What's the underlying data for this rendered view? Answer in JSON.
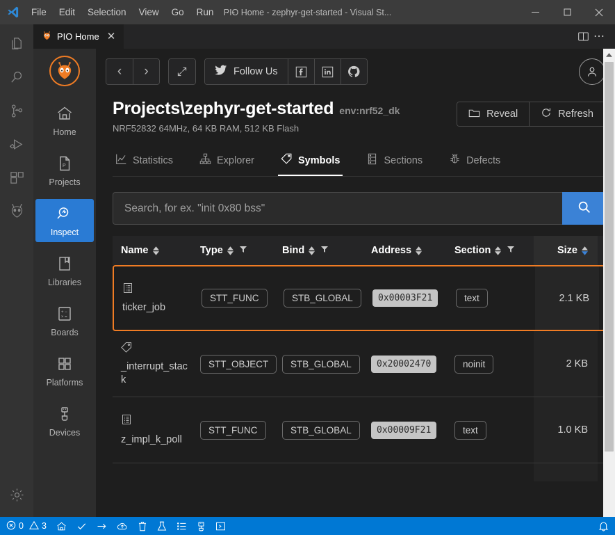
{
  "titlebar": {
    "logo_icon": "vscode-logo-icon",
    "menus": [
      {
        "label": "File"
      },
      {
        "label": "Edit"
      },
      {
        "label": "Selection"
      },
      {
        "label": "View"
      },
      {
        "label": "Go"
      },
      {
        "label": "Run"
      },
      {
        "label": "···"
      }
    ],
    "window_title": "PIO Home - zephyr-get-started - Visual St...",
    "minimize_label": "─",
    "maximize_label": "☐",
    "close_label": "✕"
  },
  "activitybar": {
    "items": [
      {
        "name": "explorer",
        "icon": "files-icon"
      },
      {
        "name": "search",
        "icon": "search-icon"
      },
      {
        "name": "source-control",
        "icon": "source-control-icon"
      },
      {
        "name": "run-and-debug",
        "icon": "run-debug-icon"
      },
      {
        "name": "extensions",
        "icon": "extensions-icon"
      },
      {
        "name": "platformio",
        "icon": "platformio-alien-icon"
      }
    ],
    "bottom": [
      {
        "name": "manage",
        "icon": "gear-icon"
      }
    ]
  },
  "tabbar": {
    "tabs": [
      {
        "label": "PIO Home",
        "icon": "platformio-alien-icon",
        "close_label": "✕",
        "active": true
      }
    ],
    "actions": [
      {
        "name": "split-editor",
        "icon": "split-editor-icon"
      },
      {
        "name": "more-actions",
        "icon": "ellipsis-icon",
        "label": "⋯"
      }
    ]
  },
  "pio_nav": {
    "logo_icon": "platformio-alien-icon",
    "items": [
      {
        "label": "Home",
        "icon": "home-icon",
        "active": false
      },
      {
        "label": "Projects",
        "icon": "projects-icon",
        "active": false
      },
      {
        "label": "Inspect",
        "icon": "inspect-icon",
        "active": true
      },
      {
        "label": "Libraries",
        "icon": "libraries-icon",
        "active": false
      },
      {
        "label": "Boards",
        "icon": "boards-icon",
        "active": false
      },
      {
        "label": "Platforms",
        "icon": "platforms-icon",
        "active": false
      },
      {
        "label": "Devices",
        "icon": "devices-icon",
        "active": false
      }
    ],
    "accent_color": "#2a7bd4",
    "brand_color": "#f07c24"
  },
  "pio_toolbar": {
    "back_label": "‹",
    "forward_label": "›",
    "expand_label": "expand",
    "follow_label": "Follow Us",
    "socials": [
      {
        "name": "facebook",
        "label": "f"
      },
      {
        "name": "linkedin",
        "label": "in"
      },
      {
        "name": "github",
        "label": "gh"
      }
    ],
    "account_label": "account"
  },
  "project": {
    "title": "Projects\\zephyr-get-started",
    "env": "env:nrf52_dk",
    "subtitle": "NRF52832 64MHz, 64 KB RAM, 512 KB Flash",
    "actions": [
      {
        "label": "Reveal",
        "icon": "folder-icon"
      },
      {
        "label": "Refresh",
        "icon": "refresh-icon"
      }
    ]
  },
  "tabs": [
    {
      "label": "Statistics",
      "icon": "chart-line-icon",
      "active": false
    },
    {
      "label": "Explorer",
      "icon": "sitemap-icon",
      "active": false
    },
    {
      "label": "Symbols",
      "icon": "tags-icon",
      "active": true
    },
    {
      "label": "Sections",
      "icon": "sections-icon",
      "active": false
    },
    {
      "label": "Defects",
      "icon": "bug-icon",
      "active": false
    }
  ],
  "search": {
    "placeholder": "Search, for ex. \"init 0x80 bss\"",
    "value": "",
    "button_icon": "search-icon",
    "button_color": "#3b82d6"
  },
  "table": {
    "columns": [
      {
        "label": "Name",
        "sortable": true,
        "filterable": false
      },
      {
        "label": "Type",
        "sortable": true,
        "filterable": true
      },
      {
        "label": "Bind",
        "sortable": true,
        "filterable": true
      },
      {
        "label": "Address",
        "sortable": true,
        "filterable": false
      },
      {
        "label": "Section",
        "sortable": true,
        "filterable": true
      },
      {
        "label": "Size",
        "sortable": true,
        "filterable": false,
        "sorted": "desc"
      }
    ],
    "rows": [
      {
        "icon": "function-symbol-icon",
        "name": "ticker_job",
        "type": "STT_FUNC",
        "bind": "STB_GLOBAL",
        "address": "0x00003F21",
        "section": "text",
        "size": "2.1 KB",
        "highlighted": true
      },
      {
        "icon": "object-tag-icon",
        "name": "_interrupt_stack",
        "type": "STT_OBJECT",
        "bind": "STB_GLOBAL",
        "address": "0x20002470",
        "section": "noinit",
        "size": "2 KB",
        "highlighted": false
      },
      {
        "icon": "function-symbol-icon",
        "name": "z_impl_k_poll",
        "type": "STT_FUNC",
        "bind": "STB_GLOBAL",
        "address": "0x00009F21",
        "section": "text",
        "size": "1.0 KB",
        "highlighted": false
      }
    ],
    "highlight_color": "#f07c24"
  },
  "statusbar": {
    "errors": "0",
    "warnings": "3",
    "items": [
      {
        "name": "pio-home",
        "icon": "home-icon"
      },
      {
        "name": "pio-build",
        "icon": "check-icon"
      },
      {
        "name": "pio-upload",
        "icon": "arrow-right-icon"
      },
      {
        "name": "pio-upload-ota",
        "icon": "cloud-upload-icon"
      },
      {
        "name": "pio-clean",
        "icon": "trash-icon"
      },
      {
        "name": "pio-test",
        "icon": "flask-icon"
      },
      {
        "name": "pio-tasks",
        "icon": "list-icon"
      },
      {
        "name": "pio-serial-monitor",
        "icon": "plug-icon"
      },
      {
        "name": "pio-terminal",
        "icon": "terminal-icon"
      }
    ],
    "notifications_icon": "bell-icon",
    "background": "#0078d4"
  }
}
